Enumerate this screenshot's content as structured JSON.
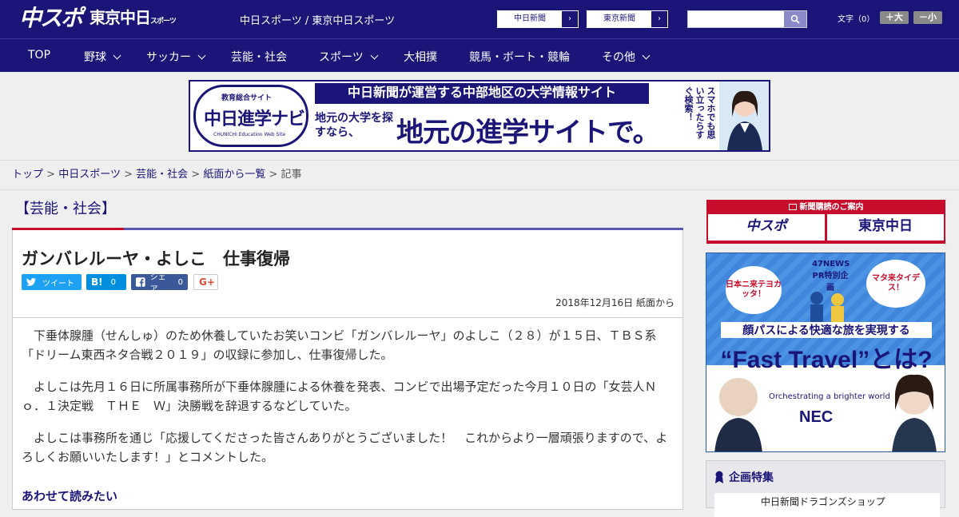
{
  "header": {
    "logo_main": "中スポ",
    "logo_sub": "東京中日",
    "logo_sub_small": "スポーツ",
    "site_name": "中日スポーツ / 東京中日スポーツ",
    "ext_links": [
      {
        "label": "中日新聞"
      },
      {
        "label": "東京新聞"
      }
    ],
    "search_placeholder": "",
    "font_size_label": "文字（0）",
    "font_plus": "＋大",
    "font_minus": "－小"
  },
  "nav": {
    "items": [
      {
        "label": "TOP",
        "dropdown": false
      },
      {
        "label": "野球",
        "dropdown": true
      },
      {
        "label": "サッカー",
        "dropdown": true
      },
      {
        "label": "芸能・社会",
        "dropdown": false
      },
      {
        "label": "スポーツ",
        "dropdown": true
      },
      {
        "label": "大相撲",
        "dropdown": false
      },
      {
        "label": "競馬・ボート・競輪",
        "dropdown": false
      },
      {
        "label": "その他",
        "dropdown": true
      }
    ]
  },
  "banner": {
    "logo_top": "教育総合サイト",
    "logo_main": "中日進学ナビ",
    "logo_bottom": "CHUNICHI Education Web Site",
    "headline": "中日新聞が運営する中部地区の大学情報サイト",
    "sub": "地元の大学を探すなら、",
    "big": "地元の進学サイトで。",
    "side": "スマホでも思い立ったらすぐ検索！"
  },
  "breadcrumb": {
    "items": [
      "トップ",
      "中日スポーツ",
      "芸能・社会",
      "紙面から一覧"
    ],
    "current": "記事",
    "sep": ">"
  },
  "article": {
    "category": "【芸能・社会】",
    "title": "ガンバレルーヤ・よしこ　仕事復帰",
    "social": {
      "tweet": "ツイート",
      "hatena_count": "0",
      "share": "シェア",
      "share_count": "0",
      "gplus": "G+"
    },
    "date": "2018年12月16日 紙面から",
    "paragraphs": [
      "　下垂体腺腫（せんしゅ）のため休養していたお笑いコンビ「ガンバレルーヤ」のよしこ（２８）が１５日、ＴＢＳ系「ドリーム東西ネタ合戦２０１９」の収録に参加し、仕事復帰した。",
      "　よしこは先月１６日に所属事務所が下垂体腺腫による休養を発表、コンビで出場予定だった今月１０日の「女芸人Ｎｏ．１決定戦　ＴＨＥ　Ｗ」決勝戦を辞退するなどしていた。",
      "　よしこは事務所を通じ「応援してくださった皆さんありがとうございました！　これからより一層頑張りますので、よろしくお願いいたします！」とコメントした。"
    ],
    "read_more": "あわせて読みたい"
  },
  "sidebar": {
    "subscribe_head": "新聞購読のご案内",
    "subscribe_logos": [
      "中スポ",
      "東京中日"
    ],
    "ad": {
      "pr": "47NEWS PR特別企画",
      "bubble1": "日本ニ来テヨカッタ！",
      "bubble2": "マタ来タイデス！",
      "headline": "顔パスによる快適な旅を実現する",
      "big": "“Fast Travel”とは?",
      "orch": "Orchestrating a brighter world",
      "brand": "NEC"
    },
    "feature_head": "企画特集",
    "feature_item": "中日新聞ドラゴンズショップ"
  },
  "colors": {
    "brand": "#1a1577",
    "accent": "#c80d2c"
  }
}
